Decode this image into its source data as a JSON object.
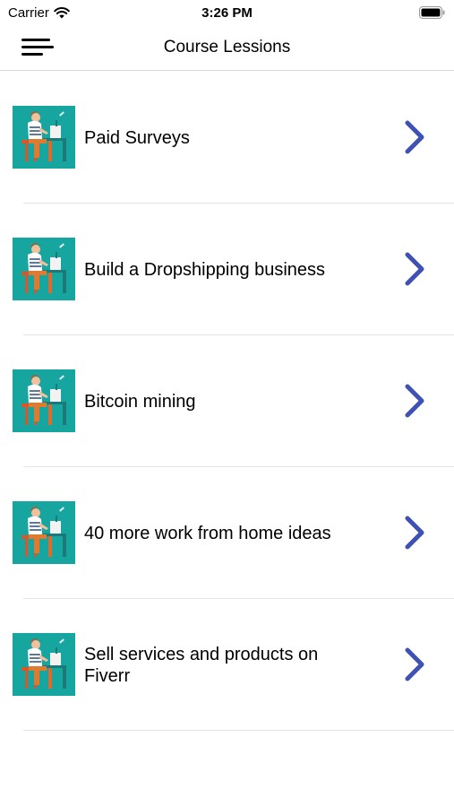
{
  "status_bar": {
    "carrier": "Carrier",
    "time": "3:26 PM",
    "icons": [
      "wifi-icon",
      "battery-icon"
    ]
  },
  "nav": {
    "title": "Course Lessions",
    "menu_icon": "hamburger-menu-icon"
  },
  "lessons": [
    {
      "label": "Paid Surveys"
    },
    {
      "label": "Build a Dropshipping business"
    },
    {
      "label": "Bitcoin mining"
    },
    {
      "label": "40 more work from home ideas"
    },
    {
      "label": "Sell services and products on Fiverr"
    }
  ],
  "colors": {
    "accent": "#3f51b5",
    "thumb_bg": "#17a5a0",
    "separator": "#e4e4e4"
  }
}
